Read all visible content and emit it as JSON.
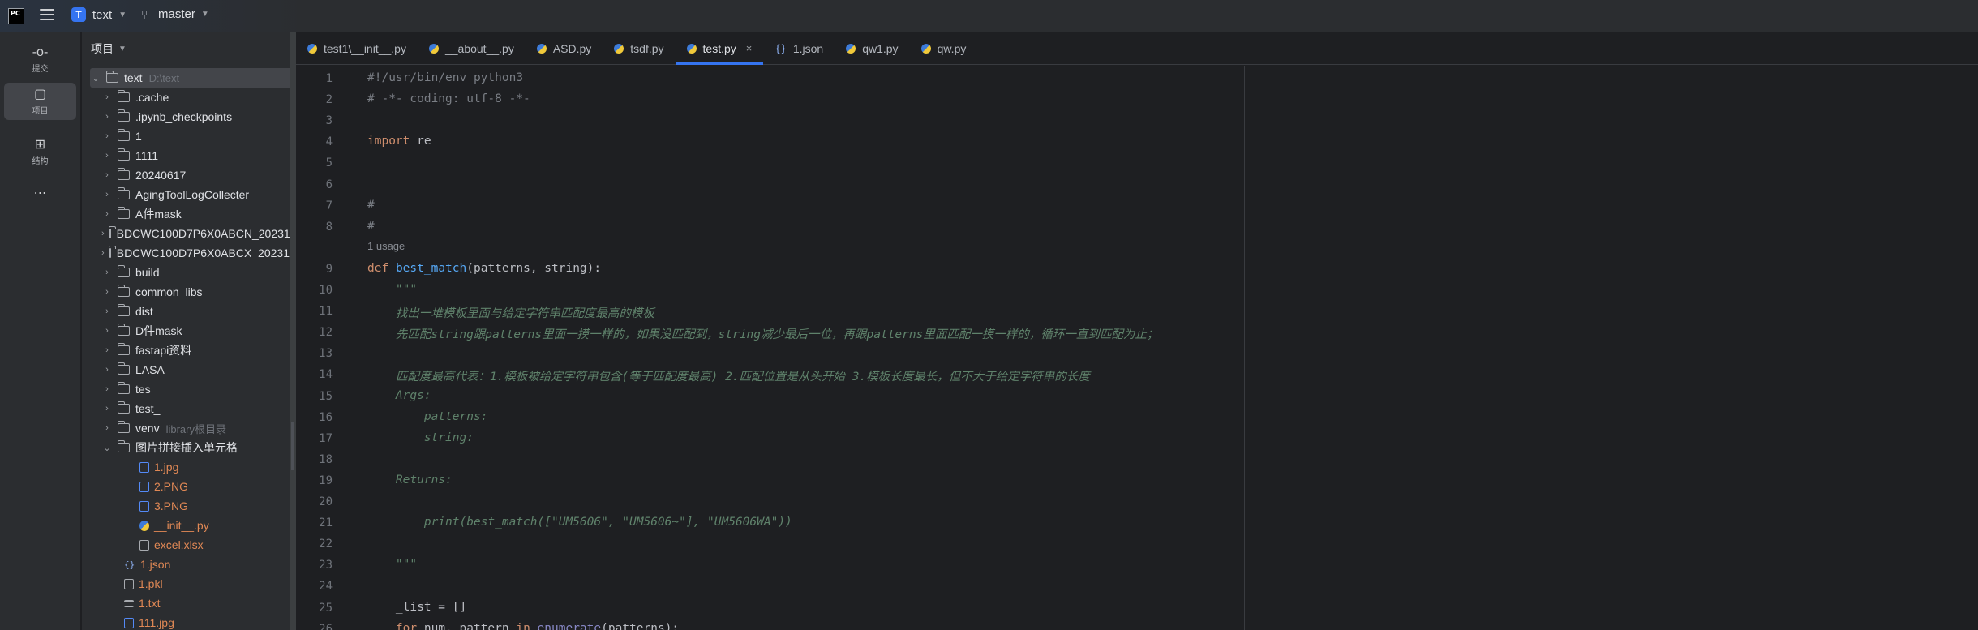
{
  "titlebar": {
    "logo": "PC",
    "project_badge": "T",
    "project_name": "text",
    "branch": "master"
  },
  "toolstrip": [
    {
      "icon": "commit-icon",
      "label": "提交",
      "glyph": "-o-"
    },
    {
      "icon": "folder-icon",
      "label": "项目",
      "glyph": "▢"
    },
    {
      "icon": "structure-icon",
      "label": "结构",
      "glyph": "⊞"
    },
    {
      "icon": "more-icon",
      "label": "",
      "glyph": "⋯"
    }
  ],
  "project_panel": {
    "title": "项目",
    "root": {
      "name": "text",
      "path": "D:\\text"
    },
    "items": [
      {
        "name": ".cache",
        "type": "folder"
      },
      {
        "name": ".ipynb_checkpoints",
        "type": "folder"
      },
      {
        "name": "1",
        "type": "folder"
      },
      {
        "name": "1111",
        "type": "folder"
      },
      {
        "name": "20240617",
        "type": "folder"
      },
      {
        "name": "AgingToolLogCollecter",
        "type": "folder"
      },
      {
        "name": "A件mask",
        "type": "folder"
      },
      {
        "name": "BDCWC100D7P6X0ABCN_20231",
        "type": "folder"
      },
      {
        "name": "BDCWC100D7P6X0ABCX_20231",
        "type": "folder"
      },
      {
        "name": "build",
        "type": "folder"
      },
      {
        "name": "common_libs",
        "type": "folder"
      },
      {
        "name": "dist",
        "type": "folder"
      },
      {
        "name": "D件mask",
        "type": "folder"
      },
      {
        "name": "fastapi资料",
        "type": "folder"
      },
      {
        "name": "LASA",
        "type": "folder"
      },
      {
        "name": "tes",
        "type": "folder"
      },
      {
        "name": "test_",
        "type": "folder"
      },
      {
        "name": "venv",
        "type": "folder",
        "hint": "library根目录"
      },
      {
        "name": "图片拼接插入单元格",
        "type": "folder-open"
      }
    ],
    "children": [
      {
        "name": "1.jpg",
        "type": "img"
      },
      {
        "name": "2.PNG",
        "type": "img"
      },
      {
        "name": "3.PNG",
        "type": "img"
      },
      {
        "name": "__init__.py",
        "type": "py"
      },
      {
        "name": "excel.xlsx",
        "type": "xls"
      }
    ],
    "files": [
      {
        "name": "1.json",
        "type": "json"
      },
      {
        "name": "1.pkl",
        "type": "xls"
      },
      {
        "name": "1.txt",
        "type": "txt"
      },
      {
        "name": "111.jpg",
        "type": "img"
      }
    ]
  },
  "tabs": [
    {
      "label": "test1\\__init__.py",
      "icon": "py"
    },
    {
      "label": "__about__.py",
      "icon": "py"
    },
    {
      "label": "ASD.py",
      "icon": "py"
    },
    {
      "label": "tsdf.py",
      "icon": "py"
    },
    {
      "label": "test.py",
      "icon": "py",
      "active": true
    },
    {
      "label": "1.json",
      "icon": "json"
    },
    {
      "label": "qw1.py",
      "icon": "py"
    },
    {
      "label": "qw.py",
      "icon": "py"
    }
  ],
  "editor": {
    "usage_hint": "1 usage",
    "lines": [
      {
        "n": "1",
        "text": "#!/usr/bin/env python3"
      },
      {
        "n": "2",
        "text": "# -*- coding: utf-8 -*-"
      },
      {
        "n": "3",
        "text": ""
      },
      {
        "n": "4",
        "text": "import re"
      },
      {
        "n": "5",
        "text": ""
      },
      {
        "n": "6",
        "text": ""
      },
      {
        "n": "7",
        "text": "#"
      },
      {
        "n": "8",
        "text": "#"
      },
      {
        "n": "9",
        "text": "def best_match(patterns, string):"
      },
      {
        "n": "10",
        "text": "    \"\"\""
      },
      {
        "n": "11",
        "text": "    找出一堆模板里面与给定字符串匹配度最高的模板"
      },
      {
        "n": "12",
        "text": "    先匹配string跟patterns里面一摸一样的，如果没匹配到，string减少最后一位，再跟patterns里面匹配一摸一样的，循环一直到匹配为止；"
      },
      {
        "n": "13",
        "text": ""
      },
      {
        "n": "14",
        "text": "    匹配度最高代表：1.模板被给定字符串包含(等于匹配度最高) 2.匹配位置是从头开始 3.模板长度最长，但不大于给定字符串的长度"
      },
      {
        "n": "15",
        "text": "    Args:"
      },
      {
        "n": "16",
        "text": "        patterns:"
      },
      {
        "n": "17",
        "text": "        string:"
      },
      {
        "n": "18",
        "text": ""
      },
      {
        "n": "19",
        "text": "    Returns:"
      },
      {
        "n": "20",
        "text": ""
      },
      {
        "n": "21",
        "text": "        print(best_match([\"UM5606\", \"UM5606~\"], \"UM5606WA\"))"
      },
      {
        "n": "22",
        "text": ""
      },
      {
        "n": "23",
        "text": "    \"\"\""
      },
      {
        "n": "24",
        "text": ""
      },
      {
        "n": "25",
        "text": "    _list = []"
      },
      {
        "n": "26",
        "text": "    for num, pattern in enumerate(patterns):"
      }
    ]
  }
}
